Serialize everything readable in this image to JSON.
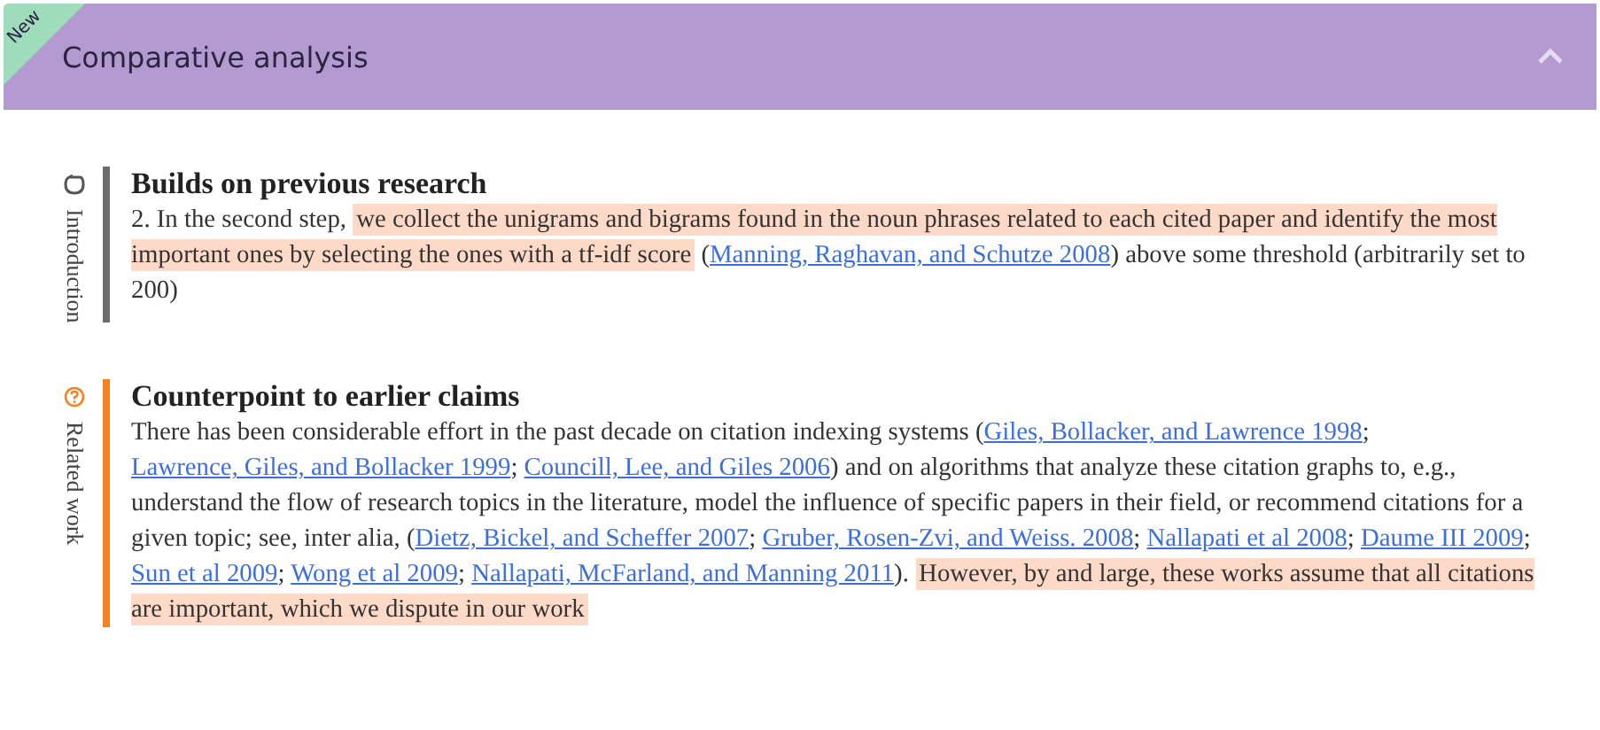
{
  "panel": {
    "badge": "New",
    "title": "Comparative analysis",
    "expanded": true
  },
  "sections": [
    {
      "section": "Introduction",
      "color": "#6b6b6b",
      "heading": "Builds on previous research",
      "paragraph": [
        {
          "kind": "text",
          "text": "2. In the second step, "
        },
        {
          "kind": "highlight",
          "text": "we collect the unigrams and bigrams found in the noun phrases related to each cited paper and identify the most important ones by selecting the ones with a tf-idf score"
        },
        {
          "kind": "text",
          "text": " ("
        },
        {
          "kind": "link",
          "text": "Manning, Raghavan, and Schutze 2008"
        },
        {
          "kind": "text",
          "text": ") above some threshold (arbitrarily set to 200)"
        }
      ]
    },
    {
      "section": "Related work",
      "color": "#f58220",
      "heading": "Counterpoint to earlier claims",
      "paragraph": [
        {
          "kind": "text",
          "text": "There has been considerable effort in the past decade on citation indexing systems ("
        },
        {
          "kind": "link",
          "text": "Giles, Bollacker, and Lawrence 1998"
        },
        {
          "kind": "text",
          "text": "; "
        },
        {
          "kind": "link",
          "text": "Lawrence, Giles, and Bollacker 1999"
        },
        {
          "kind": "text",
          "text": "; "
        },
        {
          "kind": "link",
          "text": "Councill, Lee, and Giles 2006"
        },
        {
          "kind": "text",
          "text": ") and on algorithms that analyze these citation graphs to, e.g., understand the flow of research topics in the literature, model the influence of specific papers in their field, or recommend citations for a given topic; see, inter alia, ("
        },
        {
          "kind": "link",
          "text": "Dietz, Bickel, and Scheffer 2007"
        },
        {
          "kind": "text",
          "text": "; "
        },
        {
          "kind": "link",
          "text": "Gruber, Rosen-Zvi, and Weiss. 2008"
        },
        {
          "kind": "text",
          "text": "; "
        },
        {
          "kind": "link",
          "text": "Nallapati et al 2008"
        },
        {
          "kind": "text",
          "text": "; "
        },
        {
          "kind": "link",
          "text": "Daume III 2009"
        },
        {
          "kind": "text",
          "text": "; "
        },
        {
          "kind": "link",
          "text": "Sun et al 2009"
        },
        {
          "kind": "text",
          "text": "; "
        },
        {
          "kind": "link",
          "text": "Wong et al 2009"
        },
        {
          "kind": "text",
          "text": "; "
        },
        {
          "kind": "link",
          "text": "Nallapati, McFarland, and Manning 2011"
        },
        {
          "kind": "text",
          "text": "). "
        },
        {
          "kind": "highlight",
          "text": "However, by and large, these works assume that all citations are important, which we dispute in our work"
        }
      ]
    }
  ]
}
